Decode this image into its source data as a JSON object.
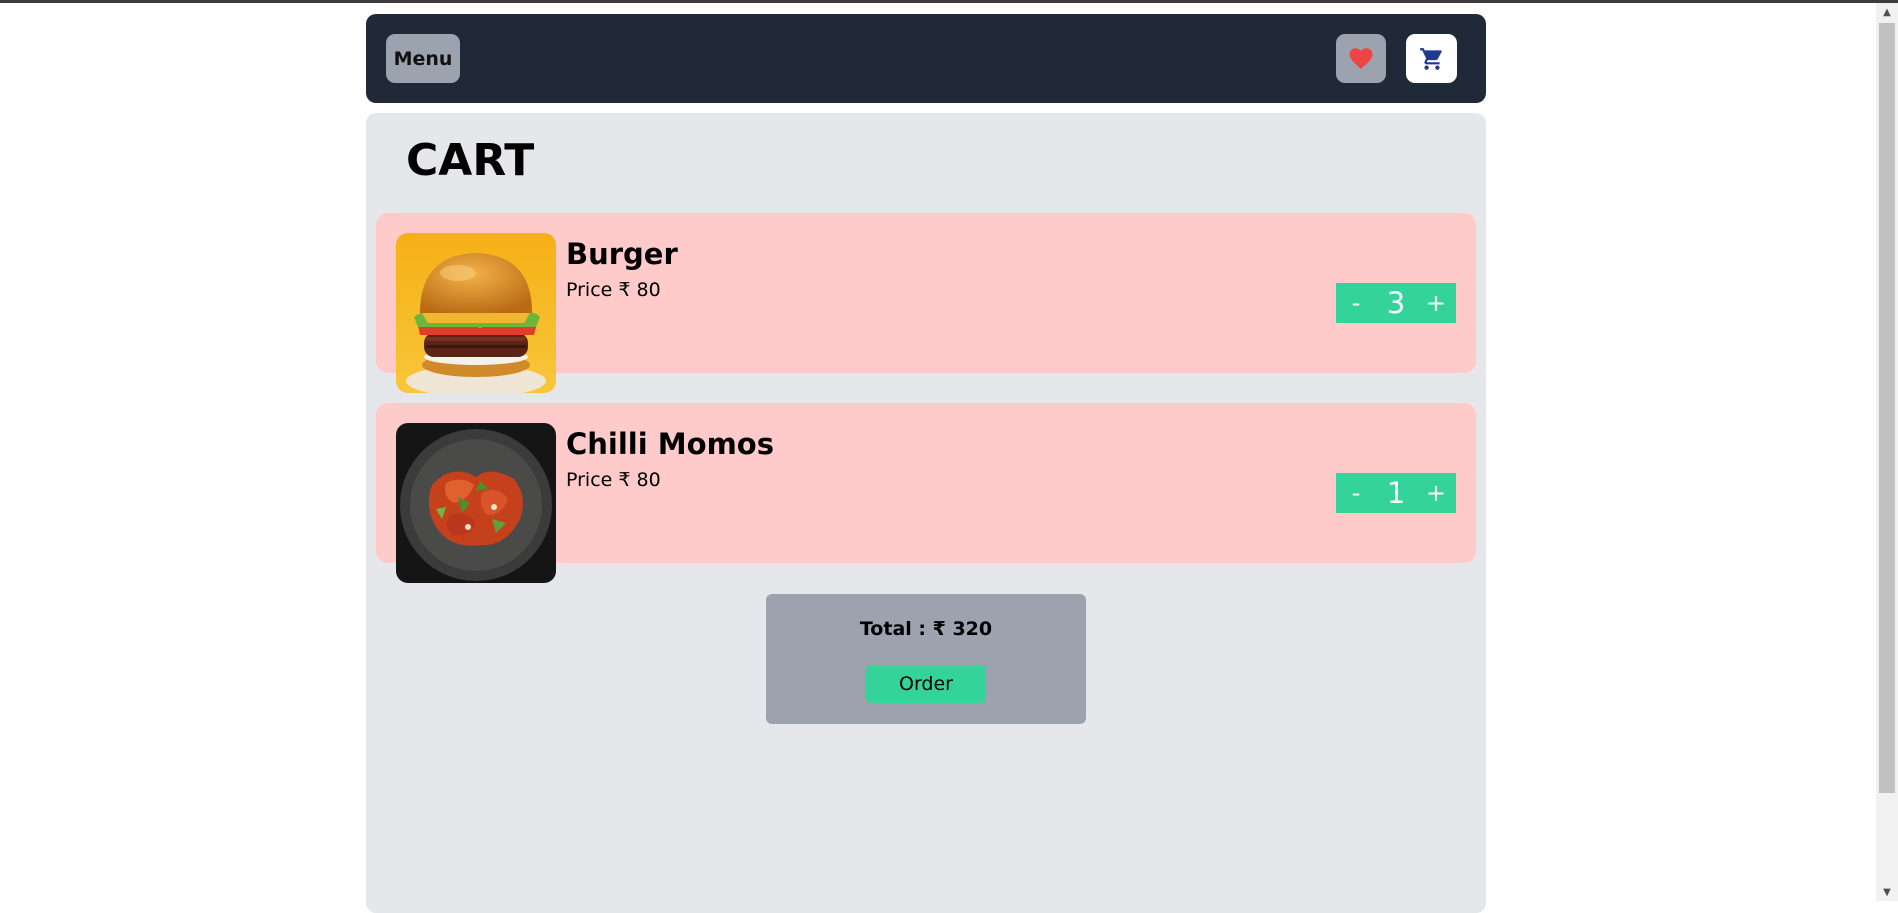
{
  "navbar": {
    "menu_label": "Menu",
    "favorite_icon": "heart-icon",
    "cart_icon": "shopping-cart-icon"
  },
  "cart": {
    "title": "CART",
    "items": [
      {
        "name": "Burger",
        "price": "Price ₹ 80",
        "quantity": "3",
        "minus": "-",
        "plus": "+"
      },
      {
        "name": "Chilli Momos",
        "price": "Price ₹ 80",
        "quantity": "1",
        "minus": "-",
        "plus": "+"
      }
    ],
    "total": "Total : ₹ 320",
    "order_label": "Order"
  },
  "colors": {
    "navbar": "#1f2937",
    "main_bg": "#e5e7eb",
    "item_bg": "#fecaca",
    "accent_green": "#34d399",
    "grey_button": "#9ca3af",
    "heart": "#ef4444"
  }
}
